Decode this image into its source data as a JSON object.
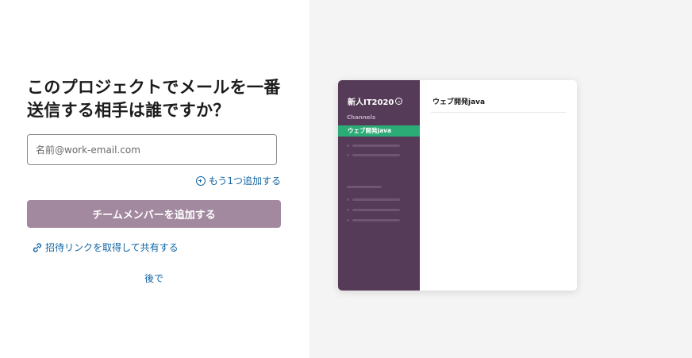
{
  "form": {
    "heading": "このプロジェクトでメールを一番送信する相手は誰ですか？",
    "email_placeholder": "名前@work-email.com",
    "add_another_label": "もう1つ追加する",
    "add_members_button": "チームメンバーを追加する",
    "invite_link_label": "招待リンクを取得して共有する",
    "later_label": "後で"
  },
  "preview": {
    "workspace_name": "新人IT2020",
    "channels_label": "Channels",
    "active_channel": "ウェブ開発java",
    "channel_title": "ウェブ開発java"
  },
  "colors": {
    "button_bg": "#a3899f",
    "sidebar_bg": "#553b58",
    "active_channel_bg": "#2bac76",
    "link": "#1264a3"
  },
  "icons": [
    "plus-circle-icon",
    "link-icon",
    "chevron-circle-icon"
  ]
}
